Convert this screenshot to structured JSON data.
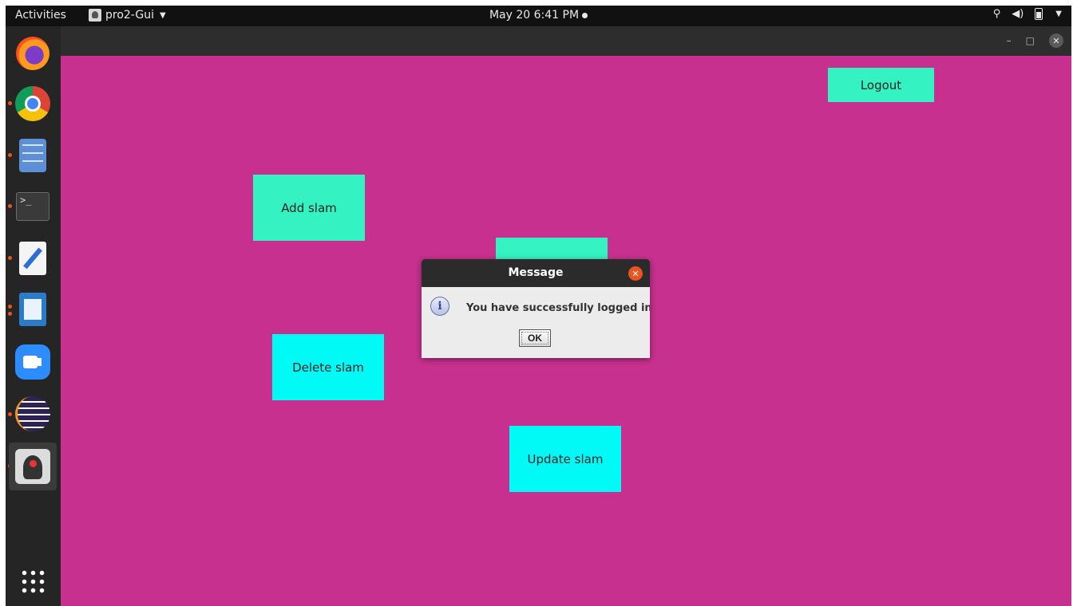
{
  "topbar": {
    "activities": "Activities",
    "app_menu": "pro2-Gui",
    "clock": "May 20  6:41 PM",
    "tray_icons": [
      "network-icon",
      "volume-icon",
      "battery-icon",
      "system-menu-icon"
    ]
  },
  "dock": {
    "apps": [
      "firefox",
      "chrome",
      "files",
      "terminal",
      "text-editor",
      "libreoffice-writer",
      "zoom",
      "eclipse",
      "java-app"
    ]
  },
  "app": {
    "logout_label": "Logout",
    "add_label": "Add slam",
    "delete_label": "Delete slam",
    "update_label": "Update slam",
    "background": "#c8308f",
    "button_green": "#35f2c2",
    "button_cyan": "#00fbf7"
  },
  "dialog": {
    "title": "Message",
    "message": "You have successfully logged in",
    "ok_label": "OK"
  }
}
